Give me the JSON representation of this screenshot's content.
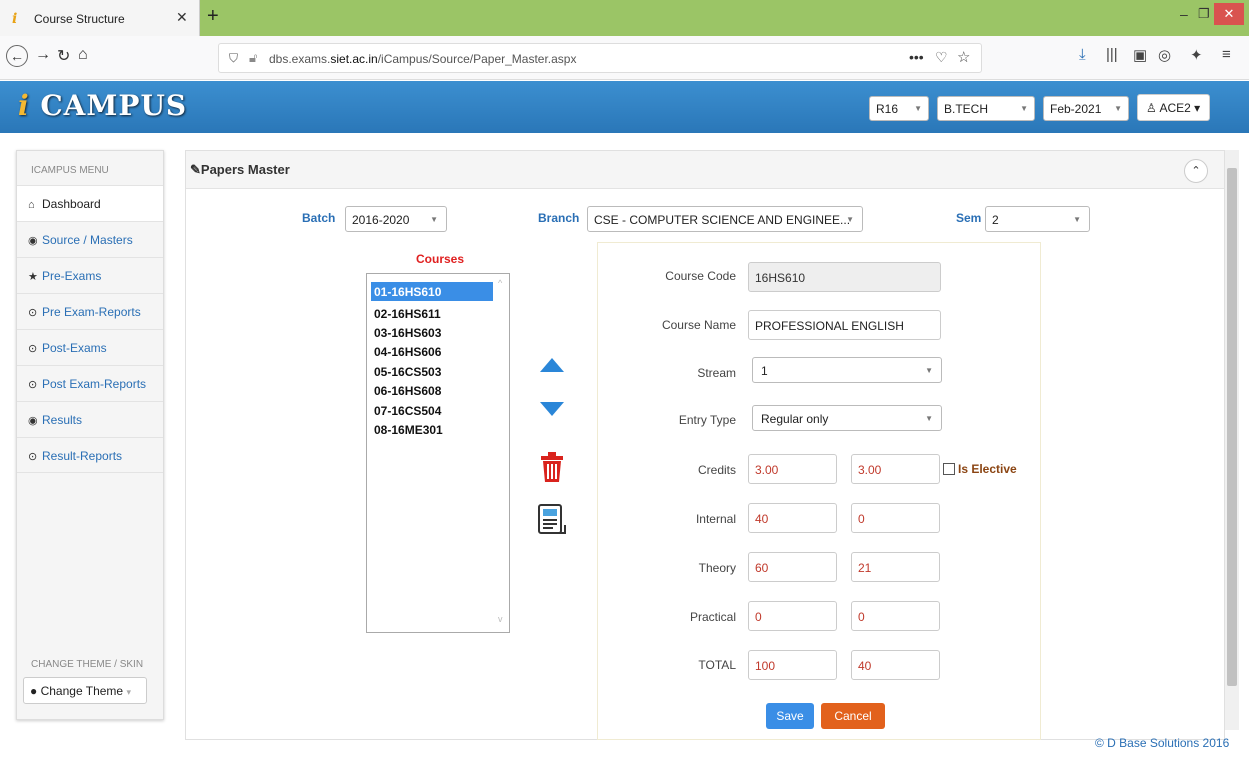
{
  "browser": {
    "tab_title": "Course Structure",
    "url_prefix": "dbs.exams.",
    "url_domain": "siet.ac.in",
    "url_path": "/iCampus/Source/Paper_Master.aspx"
  },
  "header": {
    "logo_i": "i",
    "logo_text": "CAMPUS",
    "regulation": "R16",
    "degree": "B.TECH",
    "exam": "Feb-2021",
    "user": "ACE2"
  },
  "sidebar": {
    "menu_header": "ICAMPUS MENU",
    "items": [
      {
        "icon": "⌂",
        "label": "Dashboard"
      },
      {
        "icon": "◉",
        "label": "Source / Masters"
      },
      {
        "icon": "★",
        "label": "Pre-Exams"
      },
      {
        "icon": "⊙",
        "label": "Pre Exam-Reports"
      },
      {
        "icon": "⊙",
        "label": "Post-Exams"
      },
      {
        "icon": "⊙",
        "label": "Post Exam-Reports"
      },
      {
        "icon": "◉",
        "label": "Results"
      },
      {
        "icon": "⊙",
        "label": "Result-Reports"
      }
    ],
    "theme_header": "CHANGE THEME / SKIN",
    "theme_button": "Change Theme"
  },
  "panel": {
    "title": "Papers Master",
    "batch_label": "Batch",
    "batch_value": "2016-2020",
    "branch_label": "Branch",
    "branch_value": "CSE - COMPUTER SCIENCE AND ENGINEE...",
    "sem_label": "Sem",
    "sem_value": "2",
    "courses_label": "Courses",
    "courses": [
      "01-16HS610",
      "02-16HS611",
      "03-16HS603",
      "04-16HS606",
      "05-16CS503",
      "06-16HS608",
      "07-16CS504",
      "08-16ME301"
    ]
  },
  "form": {
    "course_code_label": "Course Code",
    "course_code": "16HS610",
    "course_name_label": "Course Name",
    "course_name": "PROFESSIONAL ENGLISH",
    "stream_label": "Stream",
    "stream": "1",
    "entry_type_label": "Entry Type",
    "entry_type": "Regular only",
    "credits_label": "Credits",
    "credits_1": "3.00",
    "credits_2": "3.00",
    "elective_label": "Is Elective",
    "internal_label": "Internal",
    "internal_1": "40",
    "internal_2": "0",
    "theory_label": "Theory",
    "theory_1": "60",
    "theory_2": "21",
    "practical_label": "Practical",
    "practical_1": "0",
    "practical_2": "0",
    "total_label": "TOTAL",
    "total_1": "100",
    "total_2": "40",
    "save": "Save",
    "cancel": "Cancel"
  },
  "footer": "© D Base Solutions 2016"
}
